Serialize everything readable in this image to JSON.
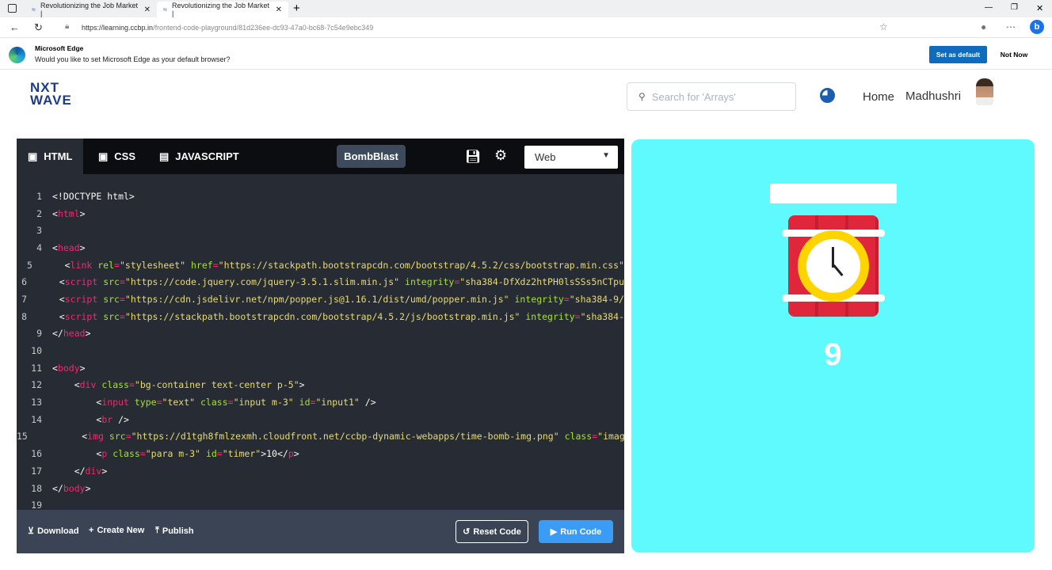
{
  "browser": {
    "tabs": [
      {
        "title": "Revolutionizing the Job Market |"
      },
      {
        "title": "Revolutionizing the Job Market |"
      }
    ],
    "url_host": "https://learning.ccbp.in",
    "url_path": "/frontend-code-playground/81d236ee-dc93-47a0-bc68-7c54e9ebc349"
  },
  "notification": {
    "title": "Microsoft Edge",
    "message": "Would you like to set Microsoft Edge as your default browser?",
    "primary": "Set as default",
    "secondary": "Not Now"
  },
  "header": {
    "logo_top": "NXT",
    "logo_bottom": "WAVE",
    "search_placeholder": "Search for 'Arrays'",
    "home": "Home",
    "user": "Madhushri"
  },
  "editor": {
    "tabs": [
      "HTML",
      "CSS",
      "JAVASCRIPT"
    ],
    "project": "BombBlast",
    "view_select": "Web",
    "lines": [
      [
        [
          "p",
          "<!DOCTYPE html>"
        ]
      ],
      [
        [
          "p",
          "<"
        ],
        [
          "t",
          "html"
        ],
        [
          "p",
          ">"
        ]
      ],
      [],
      [
        [
          "p",
          "<"
        ],
        [
          "t",
          "head"
        ],
        [
          "p",
          ">"
        ]
      ],
      [
        [
          "p",
          "    <"
        ],
        [
          "t",
          "link"
        ],
        [
          "p",
          " "
        ],
        [
          "a",
          "rel"
        ],
        [
          "t",
          "="
        ],
        [
          "s",
          "\"stylesheet\""
        ],
        [
          "p",
          " "
        ],
        [
          "a",
          "href"
        ],
        [
          "t",
          "="
        ],
        [
          "s",
          "\"https://stackpath.bootstrapcdn.com/bootstrap/4.5.2/css/bootstrap.min.css\""
        ]
      ],
      [
        [
          "p",
          "    <"
        ],
        [
          "t",
          "script"
        ],
        [
          "p",
          " "
        ],
        [
          "a",
          "src"
        ],
        [
          "t",
          "="
        ],
        [
          "s",
          "\"https://code.jquery.com/jquery-3.5.1.slim.min.js\""
        ],
        [
          "p",
          " "
        ],
        [
          "a",
          "integrity"
        ],
        [
          "t",
          "="
        ],
        [
          "s",
          "\"sha384-DfXdz2htPH0lsSSs5nCTpu"
        ]
      ],
      [
        [
          "p",
          "    <"
        ],
        [
          "t",
          "script"
        ],
        [
          "p",
          " "
        ],
        [
          "a",
          "src"
        ],
        [
          "t",
          "="
        ],
        [
          "s",
          "\"https://cdn.jsdelivr.net/npm/popper.js@1.16.1/dist/umd/popper.min.js\""
        ],
        [
          "p",
          " "
        ],
        [
          "a",
          "integrity"
        ],
        [
          "t",
          "="
        ],
        [
          "s",
          "\"sha384-9/"
        ]
      ],
      [
        [
          "p",
          "    <"
        ],
        [
          "t",
          "script"
        ],
        [
          "p",
          " "
        ],
        [
          "a",
          "src"
        ],
        [
          "t",
          "="
        ],
        [
          "s",
          "\"https://stackpath.bootstrapcdn.com/bootstrap/4.5.2/js/bootstrap.min.js\""
        ],
        [
          "p",
          " "
        ],
        [
          "a",
          "integrity"
        ],
        [
          "t",
          "="
        ],
        [
          "s",
          "\"sha384-"
        ]
      ],
      [
        [
          "p",
          "</"
        ],
        [
          "t",
          "head"
        ],
        [
          "p",
          ">"
        ]
      ],
      [],
      [
        [
          "p",
          "<"
        ],
        [
          "t",
          "body"
        ],
        [
          "p",
          ">"
        ]
      ],
      [
        [
          "p",
          "    <"
        ],
        [
          "t",
          "div"
        ],
        [
          "p",
          " "
        ],
        [
          "a",
          "class"
        ],
        [
          "t",
          "="
        ],
        [
          "s",
          "\"bg-container text-center p-5\""
        ],
        [
          "p",
          ">"
        ]
      ],
      [
        [
          "p",
          "        <"
        ],
        [
          "t",
          "input"
        ],
        [
          "p",
          " "
        ],
        [
          "a",
          "type"
        ],
        [
          "t",
          "="
        ],
        [
          "s",
          "\"text\""
        ],
        [
          "p",
          " "
        ],
        [
          "a",
          "class"
        ],
        [
          "t",
          "="
        ],
        [
          "s",
          "\"input m-3\""
        ],
        [
          "p",
          " "
        ],
        [
          "a",
          "id"
        ],
        [
          "t",
          "="
        ],
        [
          "s",
          "\"input1\""
        ],
        [
          "p",
          " />"
        ]
      ],
      [
        [
          "p",
          "        <"
        ],
        [
          "t",
          "br"
        ],
        [
          "p",
          " />"
        ]
      ],
      [
        [
          "p",
          "        <"
        ],
        [
          "t",
          "img"
        ],
        [
          "p",
          " "
        ],
        [
          "a",
          "src"
        ],
        [
          "t",
          "="
        ],
        [
          "s",
          "\"https://d1tgh8fmlzexmh.cloudfront.net/ccbp-dynamic-webapps/time-bomb-img.png\""
        ],
        [
          "p",
          " "
        ],
        [
          "a",
          "class"
        ],
        [
          "t",
          "="
        ],
        [
          "s",
          "\"imag"
        ]
      ],
      [
        [
          "p",
          "        <"
        ],
        [
          "t",
          "p"
        ],
        [
          "p",
          " "
        ],
        [
          "a",
          "class"
        ],
        [
          "t",
          "="
        ],
        [
          "s",
          "\"para m-3\""
        ],
        [
          "p",
          " "
        ],
        [
          "a",
          "id"
        ],
        [
          "t",
          "="
        ],
        [
          "s",
          "\"timer\""
        ],
        [
          "p",
          ">10</"
        ],
        [
          "t",
          "p"
        ],
        [
          "p",
          ">"
        ]
      ],
      [
        [
          "p",
          "    </"
        ],
        [
          "t",
          "div"
        ],
        [
          "p",
          ">"
        ]
      ],
      [
        [
          "p",
          "</"
        ],
        [
          "t",
          "body"
        ],
        [
          "p",
          ">"
        ]
      ],
      []
    ],
    "footer": {
      "download": "Download",
      "create": "Create New",
      "publish": "Publish",
      "reset": "Reset Code",
      "run": "Run Code"
    }
  },
  "preview": {
    "timer": "9",
    "bg": "#5ffafd"
  }
}
